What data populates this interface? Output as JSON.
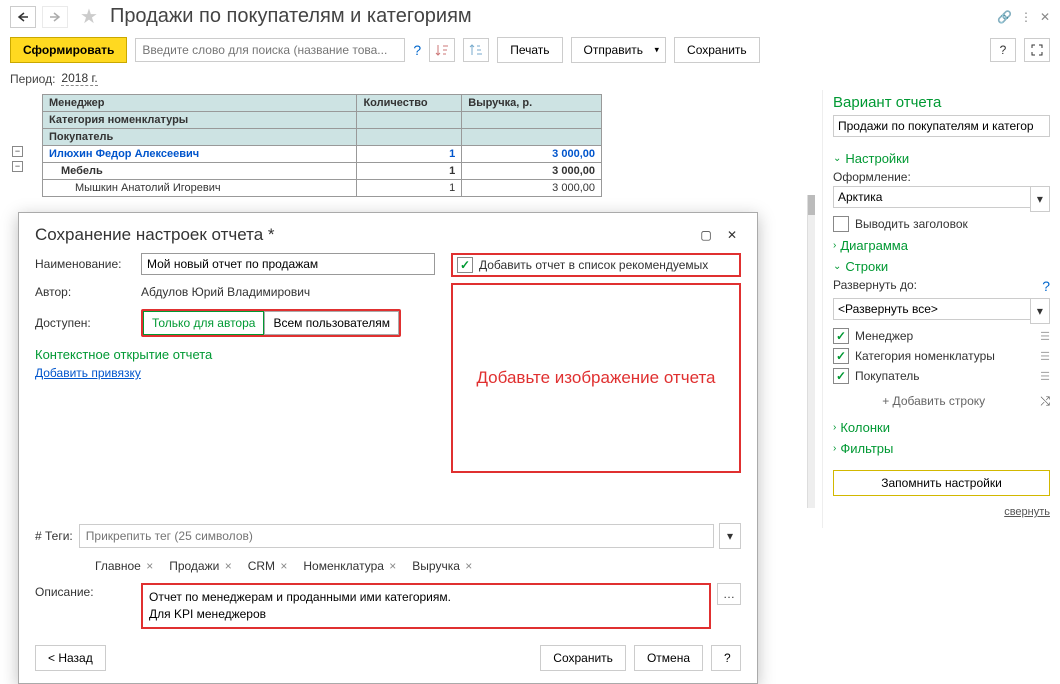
{
  "header": {
    "title": "Продажи по покупателям и категориям"
  },
  "toolbar": {
    "generate": "Сформировать",
    "search_placeholder": "Введите слово для поиска (название това...",
    "print": "Печать",
    "send": "Отправить",
    "save": "Сохранить"
  },
  "period": {
    "label": "Период:",
    "value": "2018 г."
  },
  "table": {
    "headers": {
      "c1": "Менеджер",
      "c1b": "Категория номенклатуры",
      "c1c": "Покупатель",
      "c2": "Количество",
      "c3": "Выручка, р."
    },
    "rows": [
      {
        "name": "Илюхин Федор Алексеевич",
        "qty": "1",
        "rev": "3 000,00",
        "cls": "row-blue"
      },
      {
        "name": "Мебель",
        "qty": "1",
        "rev": "3 000,00",
        "cls": "row-bold",
        "indent": 1
      },
      {
        "name": "Мышкин Анатолий Игоревич",
        "qty": "1",
        "rev": "3 000,00",
        "cls": "",
        "indent": 2
      }
    ]
  },
  "right_panel": {
    "variant_title": "Вариант отчета",
    "variant_value": "Продажи по покупателям и категор",
    "groups": {
      "settings": "Настройки",
      "diagram": "Диаграмма",
      "rows": "Строки",
      "columns": "Колонки",
      "filters": "Фильтры"
    },
    "style_label": "Оформление:",
    "style_value": "Арктика",
    "show_header": "Выводить заголовок",
    "expand_label": "Развернуть до:",
    "expand_value": "<Развернуть все>",
    "row_items": [
      "Менеджер",
      "Категория номенклатуры",
      "Покупатель"
    ],
    "add_row": "+ Добавить строку",
    "remember": "Запомнить настройки",
    "collapse": "свернуть"
  },
  "dialog": {
    "title": "Сохранение настроек отчета *",
    "name_label": "Наименование:",
    "name_value": "Мой новый отчет по продажам",
    "author_label": "Автор:",
    "author_value": "Абдулов Юрий Владимирович",
    "access_label": "Доступен:",
    "access_only": "Только для автора",
    "access_all": "Всем пользователям",
    "ctx_title": "Контекстное открытие отчета",
    "add_binding": "Добавить привязку",
    "add_to_recommended": "Добавить отчет в список рекомендуемых",
    "img_placeholder": "Добавьте изображение отчета",
    "tags_label": "# Теги:",
    "tags_placeholder": "Прикрепить тег (25 символов)",
    "tags": [
      "Главное",
      "Продажи",
      "CRM",
      "Номенклатура",
      "Выручка"
    ],
    "desc_label": "Описание:",
    "desc_value": "Отчет по менеджерам и проданными ими категориям.\nДля KPI менеджеров",
    "back": "< Назад",
    "save": "Сохранить",
    "cancel": "Отмена"
  }
}
